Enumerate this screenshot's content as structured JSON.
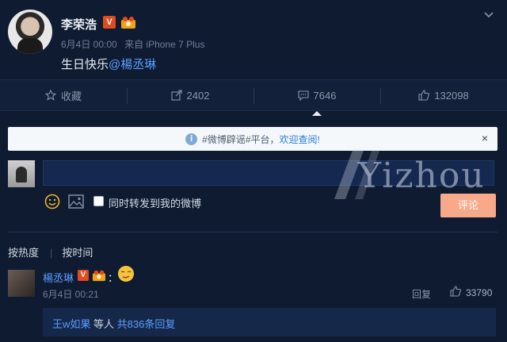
{
  "post": {
    "author": "李荣浩",
    "verified_badge": "V",
    "time": "6月4日 00:00",
    "source": "来自 iPhone 7 Plus",
    "text_prefix": "生日快乐",
    "mention": "@楊丞琳"
  },
  "actions": {
    "favorite": "收藏",
    "repost": "2402",
    "comment": "7646",
    "like": "132098"
  },
  "notice": {
    "text": "#微博辟谣#平台，",
    "link": "欢迎查阅!",
    "close": "×"
  },
  "composer": {
    "repost_label": "同时转发到我的微博",
    "submit": "评论"
  },
  "sort": {
    "hot": "按热度",
    "time": "按时间"
  },
  "comment": {
    "author": "楊丞琳",
    "verified_badge": "V",
    "colon": "：",
    "time": "6月4日 00:21",
    "reply": "回复",
    "likes": "33790",
    "replies_user": "王w如果",
    "replies_mid": "等人",
    "replies_total": "共836条回复"
  },
  "watermark": "Yizhou",
  "colors": {
    "background": "#0f1b31",
    "accent_blue": "#5b9eff",
    "submit": "#f8a98a",
    "badge": "#e24b1f"
  }
}
